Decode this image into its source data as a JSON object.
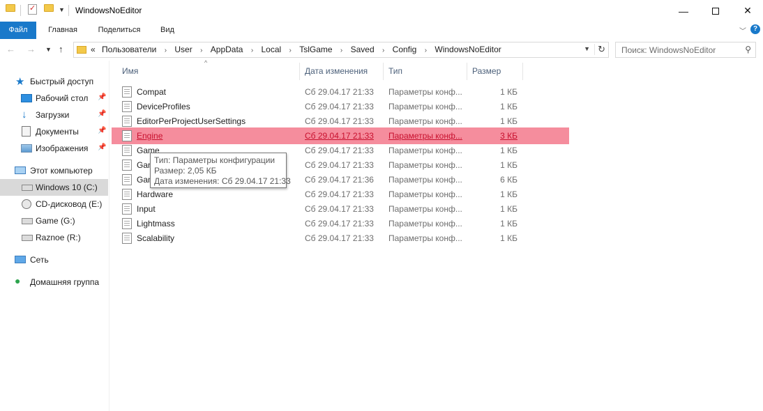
{
  "window": {
    "title": "WindowsNoEditor",
    "minimize_icon": "minimize-icon",
    "maximize_icon": "maximize-icon",
    "close_icon": "close-icon"
  },
  "ribbon": {
    "tabs": [
      {
        "label": "Файл"
      },
      {
        "label": "Главная"
      },
      {
        "label": "Поделиться"
      },
      {
        "label": "Вид"
      }
    ]
  },
  "navbar": {
    "breadcrumb": [
      "Пользователи",
      "User",
      "AppData",
      "Local",
      "TslGame",
      "Saved",
      "Config",
      "WindowsNoEditor"
    ],
    "breadcrumb_prefix": "«",
    "search_placeholder": "Поиск: WindowsNoEditor"
  },
  "sidebar": {
    "items": [
      {
        "label": "Быстрый доступ",
        "icon": "star-icon"
      },
      {
        "label": "Рабочий стол",
        "icon": "desktop-icon"
      },
      {
        "label": "Загрузки",
        "icon": "download-icon"
      },
      {
        "label": "Документы",
        "icon": "documents-icon"
      },
      {
        "label": "Изображения",
        "icon": "pictures-icon"
      },
      {
        "label": "Этот компьютер",
        "icon": "computer-icon"
      },
      {
        "label": "Windows 10 (C:)",
        "icon": "drive-icon"
      },
      {
        "label": "CD-дисковод (E:)",
        "icon": "cd-drive-icon"
      },
      {
        "label": "Game (G:)",
        "icon": "drive-icon"
      },
      {
        "label": "Raznoe (R:)",
        "icon": "drive-icon"
      },
      {
        "label": "Сеть",
        "icon": "network-icon"
      },
      {
        "label": "Домашняя группа",
        "icon": "homegroup-icon"
      }
    ]
  },
  "filelist": {
    "columns": [
      "Имя",
      "Дата изменения",
      "Тип",
      "Размер"
    ],
    "rows": [
      {
        "name": "Compat",
        "date": "Сб 29.04.17 21:33",
        "type": "Параметры конф...",
        "size": "1 КБ"
      },
      {
        "name": "DeviceProfiles",
        "date": "Сб 29.04.17 21:33",
        "type": "Параметры конф...",
        "size": "1 КБ"
      },
      {
        "name": "EditorPerProjectUserSettings",
        "date": "Сб 29.04.17 21:33",
        "type": "Параметры конф...",
        "size": "1 КБ"
      },
      {
        "name": "Engine",
        "date": "Сб 29.04.17 21:33",
        "type": "Параметры конф...",
        "size": "3 КБ"
      },
      {
        "name": "Game",
        "date": "Сб 29.04.17 21:33",
        "type": "Параметры конф...",
        "size": "1 КБ"
      },
      {
        "name": "Gam",
        "date": "Сб 29.04.17 21:33",
        "type": "Параметры конф...",
        "size": "1 КБ"
      },
      {
        "name": "Gam",
        "date": "Сб 29.04.17 21:36",
        "type": "Параметры конф...",
        "size": "6 КБ"
      },
      {
        "name": "Hardware",
        "date": "Сб 29.04.17 21:33",
        "type": "Параметры конф...",
        "size": "1 КБ"
      },
      {
        "name": "Input",
        "date": "Сб 29.04.17 21:33",
        "type": "Параметры конф...",
        "size": "1 КБ"
      },
      {
        "name": "Lightmass",
        "date": "Сб 29.04.17 21:33",
        "type": "Параметры конф...",
        "size": "1 КБ"
      },
      {
        "name": "Scalability",
        "date": "Сб 29.04.17 21:33",
        "type": "Параметры конф...",
        "size": "1 КБ"
      }
    ]
  },
  "tooltip": {
    "line1": "Тип: Параметры конфигурации",
    "line2": "Размер: 2,05 КБ",
    "line3": "Дата изменения: Сб 29.04.17 21:33"
  },
  "colors": {
    "accent": "#1979ca",
    "highlight": "#f58d9d",
    "highlight_text": "#c8102e",
    "folder": "#f3c94a"
  }
}
